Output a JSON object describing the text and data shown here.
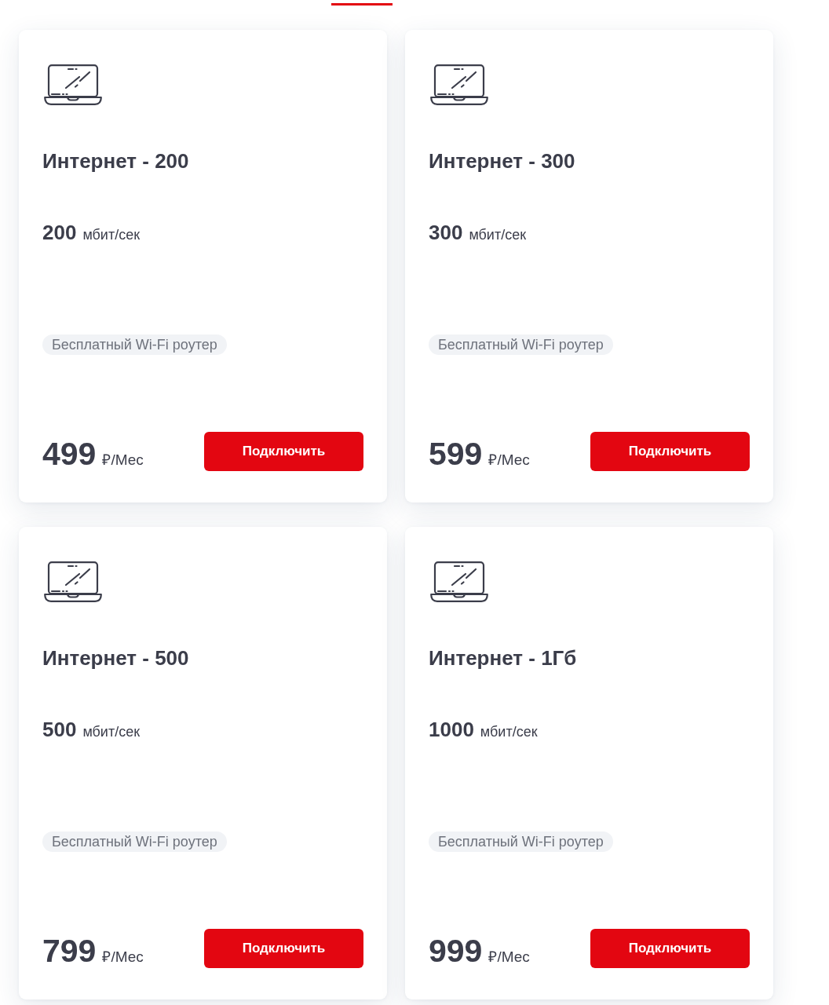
{
  "tab": {
    "selected": true
  },
  "plans": [
    {
      "title": "Интернет - 200",
      "speed": "200",
      "speed_unit": "мбит/сек",
      "badge": "Бесплатный Wi-Fi роутер",
      "price": "499",
      "price_unit": "₽/Мес",
      "button": "Подключить"
    },
    {
      "title": "Интернет - 300",
      "speed": "300",
      "speed_unit": "мбит/сек",
      "badge": "Бесплатный Wi-Fi роутер",
      "price": "599",
      "price_unit": "₽/Мес",
      "button": "Подключить"
    },
    {
      "title": "Интернет - 500",
      "speed": "500",
      "speed_unit": "мбит/сек",
      "badge": "Бесплатный Wi-Fi роутер",
      "price": "799",
      "price_unit": "₽/Мес",
      "button": "Подключить"
    },
    {
      "title": "Интернет - 1Гб",
      "speed": "1000",
      "speed_unit": "мбит/сек",
      "badge": "Бесплатный Wi-Fi роутер",
      "price": "999",
      "price_unit": "₽/Мес",
      "button": "Подключить"
    }
  ]
}
